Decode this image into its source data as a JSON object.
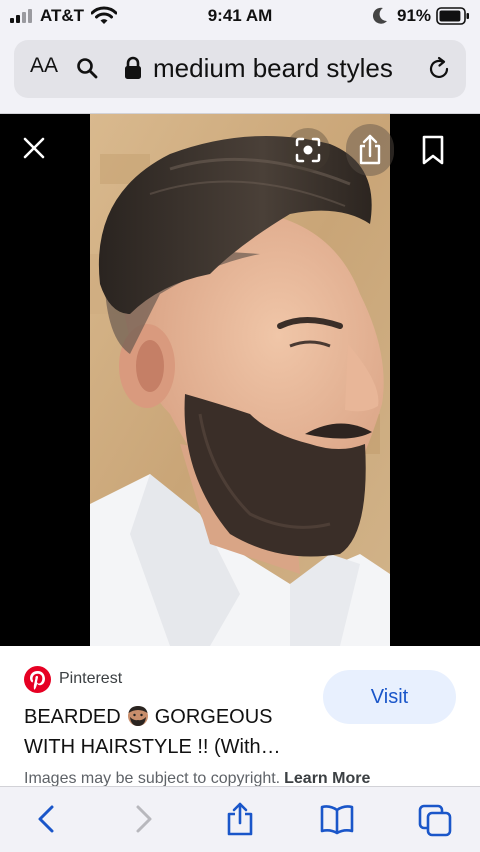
{
  "status_bar": {
    "carrier": "AT&T",
    "time": "9:41 AM",
    "battery_percent": "91%",
    "battery_level": 0.91,
    "icons": [
      "signal-icon",
      "wifi-icon",
      "moon-icon",
      "battery-icon"
    ]
  },
  "url_bar": {
    "text_size_label": "AA",
    "url_text": "medium beard styles",
    "icons": [
      "search-icon",
      "lock-icon",
      "reload-icon"
    ]
  },
  "viewer": {
    "icons": [
      "close-icon",
      "lens-icon",
      "share-icon",
      "bookmark-icon"
    ]
  },
  "result": {
    "source": "Pinterest",
    "title_part1": "BEARDED",
    "title_part2": "GORGEOUS",
    "title_line2": "WITH HAIRSTYLE !! (With…",
    "visit_label": "Visit",
    "copyright_text": "Images may be subject to copyright.",
    "learn_more": "Learn More"
  },
  "toolbar": {
    "icons": [
      "back-icon",
      "forward-icon",
      "share-icon",
      "bookmarks-icon",
      "tabs-icon"
    ]
  },
  "colors": {
    "accent": "#1a56c9",
    "visit_bg": "#e8f0fe",
    "pinterest_red": "#e60023",
    "chrome_bg": "#f2f2f7"
  }
}
